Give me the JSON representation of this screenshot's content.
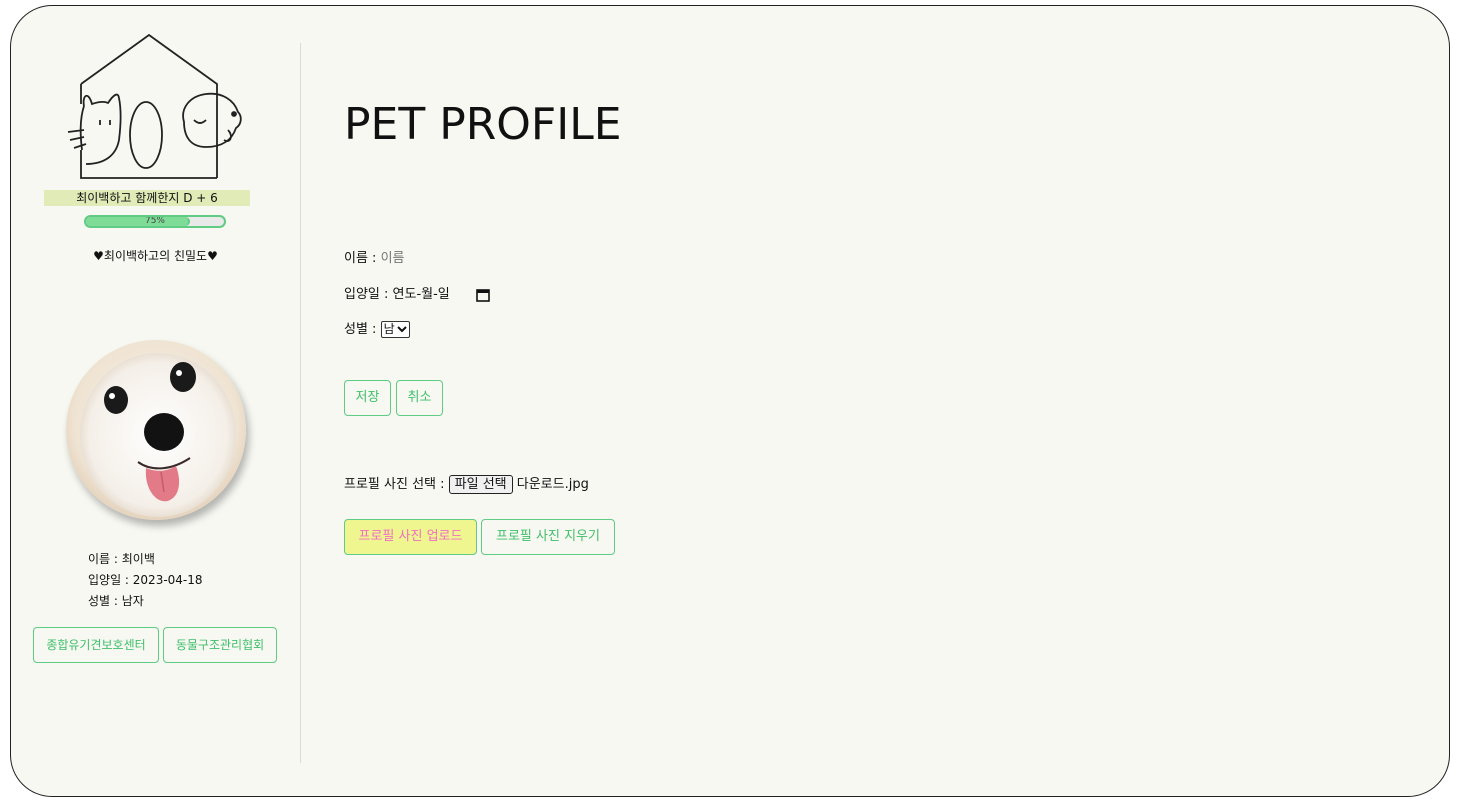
{
  "sidebar": {
    "dday_text": "최이백하고 함께한지 D + 6",
    "progress": {
      "percent": 75,
      "label": "75%"
    },
    "intimacy_text": "♥최이백하고의 친밀도♥",
    "pet_info": {
      "name": "이름 : 최이백",
      "adopted": "입양일 : 2023-04-18",
      "gender": "성별 : 남자"
    },
    "links": [
      "종합유기견보호센터",
      "동물구조관리협회"
    ]
  },
  "main": {
    "title": "PET PROFILE",
    "form": {
      "name_label": "이름 :",
      "name_placeholder": "이름",
      "date_label": "입양일 :",
      "date_value": "연도-월-일",
      "gender_label": "성별 :",
      "gender_selected": "남"
    },
    "buttons": {
      "save": "저장",
      "cancel": "취소"
    },
    "photo": {
      "label": "프로필 사진 선택 :",
      "file_button": "파일 선택",
      "file_name": "다운로드.jpg",
      "upload": "프로필 사진 업로드",
      "delete": "프로필 사진 지우기"
    }
  },
  "colors": {
    "accent_green": "#5fcb83",
    "highlight_yellow": "#f0f68f",
    "upload_text_pink": "#f06fc4",
    "dday_bg": "#e1ebb7",
    "panel_bg": "#f7f8f2"
  },
  "icons": [
    "house-cat-dog-logo-icon",
    "calendar-icon",
    "chevron-down-icon"
  ]
}
